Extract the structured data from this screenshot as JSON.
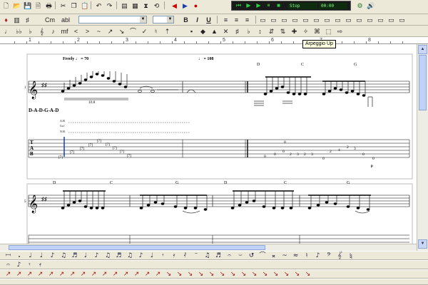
{
  "toolbar1": {
    "row1_icons": [
      {
        "name": "new-file-icon",
        "glyph": "🗋"
      },
      {
        "name": "open-file-icon",
        "glyph": "📂"
      },
      {
        "name": "save-icon",
        "glyph": "💾"
      },
      {
        "name": "print-preview-icon",
        "glyph": "🗎"
      },
      {
        "name": "print-icon",
        "glyph": "🖶"
      },
      {
        "name": "cut-icon",
        "glyph": "✂"
      },
      {
        "name": "copy-icon",
        "glyph": "❐"
      },
      {
        "name": "paste-icon",
        "glyph": "📋"
      },
      {
        "name": "undo-icon",
        "glyph": "↶"
      },
      {
        "name": "redo-icon",
        "glyph": "↷"
      },
      {
        "name": "multitrack-view-icon",
        "glyph": "▤"
      },
      {
        "name": "score-view-icon",
        "glyph": "▦"
      },
      {
        "name": "metronome-icon",
        "glyph": "⧗"
      },
      {
        "name": "loop-icon",
        "glyph": "⟲"
      }
    ],
    "transport": {
      "time": "00:00",
      "status": "Stop"
    }
  },
  "toolbar2": {
    "icons": [
      {
        "name": "guitar-icon",
        "glyph": "🎸"
      },
      {
        "name": "track-properties-icon",
        "glyph": "▥"
      },
      {
        "name": "chord-icon",
        "glyph": "♯"
      },
      {
        "name": "text-icon",
        "glyph": "A"
      },
      {
        "name": "bold-icon",
        "glyph": "B"
      },
      {
        "name": "italic-icon",
        "glyph": "I"
      },
      {
        "name": "underline-icon",
        "glyph": "U"
      }
    ],
    "small_labels": [
      "Cm",
      "abl"
    ],
    "style_buttons": [
      "B",
      "I",
      "U"
    ]
  },
  "toolbar3": {
    "symbols": [
      "♩",
      "♭♭",
      "♭",
      "𝄞",
      "♪",
      "mf",
      "<",
      ">",
      "~",
      "↗",
      "↘",
      "⌒",
      "✓",
      "♮",
      "⇡"
    ]
  },
  "tooltip": "Arpeggio Up",
  "ruler": {
    "labels": [
      "1",
      "2",
      "3",
      "4",
      "5",
      "6",
      "7",
      "8"
    ]
  },
  "score": {
    "tempo1": "Freely ♩ = 70",
    "tempo2": "♩ = 108",
    "tuning": "D-A-D-G-A-D",
    "system1_number": "1",
    "system2_number": "5",
    "triplet_label": "10:8",
    "effect_labels": [
      "A.H",
      "Gr.f",
      "N.H."
    ],
    "tab_letters": [
      "T",
      "A",
      "B"
    ],
    "chords_system1": [
      "D",
      "C",
      "G"
    ],
    "chords_system2": [
      "D",
      "C",
      "G",
      "D",
      "C",
      "G"
    ],
    "tab_numbers_bar1": [
      "[7]",
      "[7]",
      "[7]",
      "[7]",
      "[7]",
      "[7]",
      "[7]",
      "[7]",
      "[7]"
    ],
    "tab_numbers_bar3": [
      "0",
      "0",
      "0",
      "0",
      "2",
      "3",
      "2",
      "3"
    ],
    "tab_numbers_bar4": [
      "0",
      "2",
      "4",
      "2",
      "3",
      "0",
      "0"
    ],
    "p_label": "p"
  },
  "palette1": [
    "𝄩",
    "𝅗",
    "♩",
    "♩",
    "♪",
    "♫",
    "♬",
    "♩",
    "♪",
    "♫",
    "♬",
    "♫",
    "♪",
    "♩",
    "𝄾",
    "𝄿",
    "𝅀",
    "𝄻",
    "♫",
    "♬",
    "𝄐",
    "𝄑",
    "↺",
    "⌒",
    "𝄪",
    "~",
    "≈",
    "♮",
    "♪",
    "𝄢",
    "𝄟",
    "𝄮"
  ],
  "palette2": [
    "𝄐",
    "♪",
    "𝄾",
    "𝄿"
  ],
  "palette3": [
    "↗",
    "↗",
    "↗",
    "↗",
    "↗",
    "↗",
    "↗",
    "↗",
    "↗",
    "↗",
    "↗",
    "↗",
    "↗",
    "↗",
    "↗",
    "↘",
    "↘",
    "↘",
    "↘",
    "↘",
    "↘",
    "↘",
    "↘",
    "↘",
    "↘",
    "↘",
    "↘",
    "↘",
    "↘"
  ]
}
